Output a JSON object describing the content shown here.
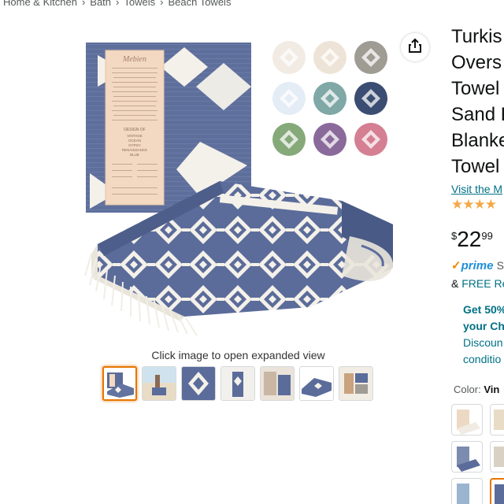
{
  "breadcrumb": {
    "items": [
      "Home & Kitchen",
      "Bath",
      "Towels",
      "Beach Towels"
    ],
    "separator": "›"
  },
  "gallery": {
    "caption": "Click image to open expanded view",
    "label_card": {
      "brand": "Mebien",
      "design_of": "DESIGN OF",
      "design_lines": [
        "VINTAGE",
        "OCEAN",
        "GYPSY",
        "RENAISSANCE",
        "BLUE"
      ]
    },
    "swatch_colors": [
      "#f1ebe4",
      "#ede4d7",
      "#9e9c93",
      "#e4ecf5",
      "#7fa8a6",
      "#3b4d72",
      "#86a97a",
      "#8a6a9a",
      "#d57f92"
    ],
    "thumbnail_count": 7,
    "selected_thumbnail": 1
  },
  "product": {
    "title_lines": [
      "Turkis",
      "Overs",
      "Towel",
      "Sand F",
      "Blanke",
      "Towel"
    ],
    "visit_link": "Visit the M",
    "stars": "★★★★",
    "price_symbol": "$",
    "price_whole": "22",
    "price_fraction": "99",
    "prime_check": "✓",
    "prime_word": "prime",
    "prime_rest": "S",
    "returns_prefix": "& ",
    "returns_link": "FREE Re",
    "promo_lines_bold": [
      "Get 50%",
      "your Ch"
    ],
    "promo_lines_link": [
      "Discoun",
      "conditio"
    ],
    "color_label": "Color:",
    "color_value": "Vin"
  },
  "colors": {
    "towel_blue": "#5b6c9a",
    "towel_cream": "#f4f1ea",
    "label_card": "#f3d9c2",
    "amazon_link": "#007185",
    "prime_blue": "#1f8fd6",
    "selected_orange": "#e77600",
    "star_orange": "#f3a847"
  }
}
